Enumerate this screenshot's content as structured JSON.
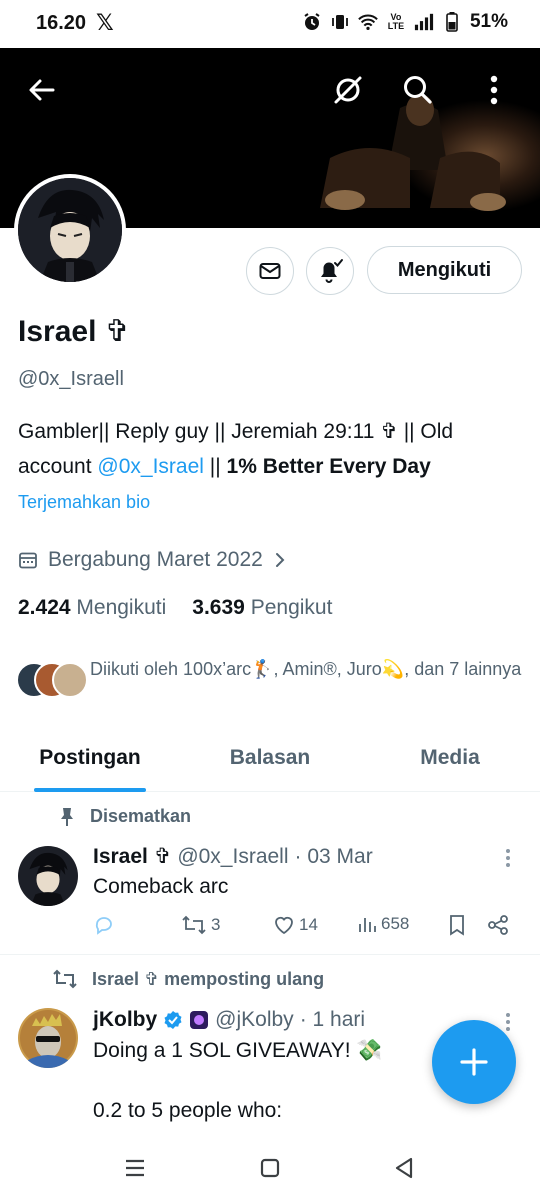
{
  "status_bar": {
    "time": "16.20",
    "app_logo": "𝕏",
    "battery": "51%",
    "icons": [
      "alarm-icon",
      "vibrate-icon",
      "wifi-icon",
      "volte-icon",
      "signal-icon",
      "battery-icon"
    ]
  },
  "header": {
    "back_icon": "arrow-left-icon",
    "grok_icon": "grok-icon",
    "search_icon": "search-icon",
    "menu_icon": "more-vertical-icon"
  },
  "profile": {
    "name": "Israel ✞",
    "handle": "@0x_Israell",
    "bio_part1": "Gambler|| Reply guy || Jeremiah 29:11 ✞ ||  Old account ",
    "bio_link": "@0x_Israel",
    "bio_part2": "  || ",
    "bio_bold": "1% Better Every Day",
    "translate_label": "Terjemahkan bio",
    "joined": "Bergabung Maret 2022",
    "following_count": "2.424",
    "following_label": "Mengikuti",
    "followers_count": "3.639",
    "followers_label": "Pengikut",
    "followed_by": "Diikuti oleh 100x’arc🏌, Amin®, Juro💫, dan 7 lainnya"
  },
  "actions": {
    "follow_label": "Mengikuti"
  },
  "tabs": [
    {
      "label": "Postingan",
      "active": true
    },
    {
      "label": "Balasan",
      "active": false
    },
    {
      "label": "Media",
      "active": false
    }
  ],
  "pinned_label": "Disematkan",
  "posts": [
    {
      "name": "Israel ✞",
      "handle": "@0x_Israell",
      "date": "· 03 Mar",
      "text": "Comeback arc",
      "reply_count": "",
      "repost_count": "3",
      "like_count": "14",
      "view_count": "658"
    },
    {
      "repost_label": "Israel ✞ memposting ulang",
      "name": "jKolby",
      "handle": "@jKolby",
      "date": "· 1 hari",
      "text1": "Doing a 1 SOL GIVEAWAY! 💸",
      "text2": "0.2 to 5 people who:"
    }
  ],
  "colors": {
    "accent": "#1d9bf0",
    "text": "#0f1419",
    "muted": "#536471"
  }
}
